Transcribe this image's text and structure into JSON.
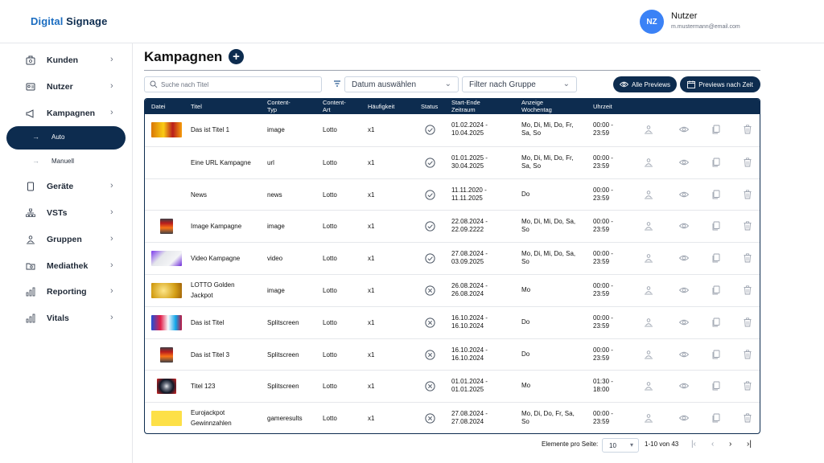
{
  "app": {
    "title_part1": "Digital",
    "title_part2": "Signage"
  },
  "user": {
    "initials": "NZ",
    "name": "Nutzer",
    "email": "m.mustermann@email.com"
  },
  "sidebar": {
    "items": [
      {
        "label": "Kunden",
        "icon": "customers-icon"
      },
      {
        "label": "Nutzer",
        "icon": "user-card-icon"
      },
      {
        "label": "Kampagnen",
        "icon": "megaphone-icon"
      },
      {
        "label": "Geräte",
        "icon": "device-icon"
      },
      {
        "label": "VSTs",
        "icon": "hierarchy-icon"
      },
      {
        "label": "Gruppen",
        "icon": "group-icon"
      },
      {
        "label": "Mediathek",
        "icon": "media-folder-icon"
      },
      {
        "label": "Reporting",
        "icon": "bar-chart-icon"
      },
      {
        "label": "Vitals",
        "icon": "vitals-chart-icon"
      }
    ],
    "subitems": [
      {
        "label": "Auto",
        "active": true
      },
      {
        "label": "Manuell",
        "active": false
      }
    ]
  },
  "page": {
    "title": "Kampagnen"
  },
  "toolbar": {
    "search_placeholder": "Suche nach Titel",
    "date_label": "Datum auswählen",
    "group_label": "Filter nach Gruppe",
    "all_previews": "Alle Previews",
    "previews_by_time": "Previews nach Zeit"
  },
  "table": {
    "headers": {
      "file": "Datei",
      "title": "Titel",
      "content_type_1": "Content-",
      "content_type_2": "Typ",
      "content_kind_1": "Content-",
      "content_kind_2": "Art",
      "frequency": "Häufigkeit",
      "status": "Status",
      "period_1": "Start-Ende",
      "period_2": "Zeitraum",
      "weekday_1": "Anzeige",
      "weekday_2": "Wochentag",
      "time": "Uhrzeit"
    },
    "rows": [
      {
        "title_1": "Das ist Titel 1",
        "title_2": "",
        "type": "image",
        "kind": "Lotto",
        "freq": "x1",
        "status": "ok",
        "period_1": "01.02.2024 -",
        "period_2": "10.04.2025",
        "days_1": "Mo, Di, Mi, Do, Fr,",
        "days_2": "Sa, So",
        "time_1": "00:00 -",
        "time_2": "23:59",
        "thumb": "thumb-yellow"
      },
      {
        "title_1": "Eine URL Kampagne",
        "title_2": "",
        "type": "url",
        "kind": "Lotto",
        "freq": "x1",
        "status": "ok",
        "period_1": "01.01.2025 -",
        "period_2": "30.04.2025",
        "days_1": "Mo, Di, Mi, Do, Fr,",
        "days_2": "Sa, So",
        "time_1": "00:00 -",
        "time_2": "23:59",
        "thumb": "none"
      },
      {
        "title_1": "News",
        "title_2": "",
        "type": "news",
        "kind": "Lotto",
        "freq": "x1",
        "status": "ok",
        "period_1": "11.11.2020 -",
        "period_2": "11.11.2025",
        "days_1": "Do",
        "days_2": "",
        "time_1": "00:00 -",
        "time_2": "23:59",
        "thumb": "none"
      },
      {
        "title_1": "Image Kampagne",
        "title_2": "",
        "type": "image",
        "kind": "Lotto",
        "freq": "x1",
        "status": "ok",
        "period_1": "22.08.2024 -",
        "period_2": "22.09.2222",
        "days_1": "Mo, Di, Mi, Do, Sa,",
        "days_2": "So",
        "time_1": "00:00 -",
        "time_2": "23:59",
        "thumb": "thumb-phone"
      },
      {
        "title_1": "Video Kampagne",
        "title_2": "",
        "type": "video",
        "kind": "Lotto",
        "freq": "x1",
        "status": "ok",
        "period_1": "27.08.2024 -",
        "period_2": "03.09.2025",
        "days_1": "Mo, Di, Mi, Do, Sa,",
        "days_2": "So",
        "time_1": "00:00 -",
        "time_2": "23:59",
        "thumb": "thumb-screen"
      },
      {
        "title_1": "LOTTO Golden",
        "title_2": "Jackpot",
        "type": "image",
        "kind": "Lotto",
        "freq": "x1",
        "status": "x",
        "period_1": "26.08.2024 -",
        "period_2": "26.08.2024",
        "days_1": "Mo",
        "days_2": "",
        "time_1": "00:00 -",
        "time_2": "23:59",
        "thumb": "thumb-gold"
      },
      {
        "title_1": "Das ist Titel",
        "title_2": "",
        "type": "Splitscreen",
        "kind": "Lotto",
        "freq": "x1",
        "status": "x",
        "period_1": "16.10.2024 -",
        "period_2": "16.10.2024",
        "days_1": "Do",
        "days_2": "",
        "time_1": "00:00 -",
        "time_2": "23:59",
        "thumb": "thumb-mixed"
      },
      {
        "title_1": "Das ist Titel 3",
        "title_2": "",
        "type": "Splitscreen",
        "kind": "Lotto",
        "freq": "x1",
        "status": "x",
        "period_1": "16.10.2024 -",
        "period_2": "16.10.2024",
        "days_1": "Do",
        "days_2": "",
        "time_1": "00:00 -",
        "time_2": "23:59",
        "thumb": "thumb-phone"
      },
      {
        "title_1": "Titel 123",
        "title_2": "",
        "type": "Splitscreen",
        "kind": "Lotto",
        "freq": "x1",
        "status": "x",
        "period_1": "01.01.2024 -",
        "period_2": "01.01.2025",
        "days_1": "Mo",
        "days_2": "",
        "time_1": "01:30 -",
        "time_2": "18:00",
        "thumb": "thumb-dark"
      },
      {
        "title_1": "Eurojackpot",
        "title_2": "Gewinnzahlen",
        "type": "gameresults",
        "kind": "Lotto",
        "freq": "x1",
        "status": "x",
        "period_1": "27.08.2024 -",
        "period_2": "27.08.2024",
        "days_1": "Mo, Di, Do, Fr, Sa,",
        "days_2": "So",
        "time_1": "00:00 -",
        "time_2": "23:59",
        "thumb": "thumb-plainyellow"
      }
    ]
  },
  "pagination": {
    "per_page_label": "Elemente pro Seite:",
    "per_page_value": "10",
    "range": "1-10 von 43"
  },
  "colors": {
    "primary": "#0d2c4f",
    "accent": "#1b6dc1",
    "avatar": "#3b82f6"
  }
}
